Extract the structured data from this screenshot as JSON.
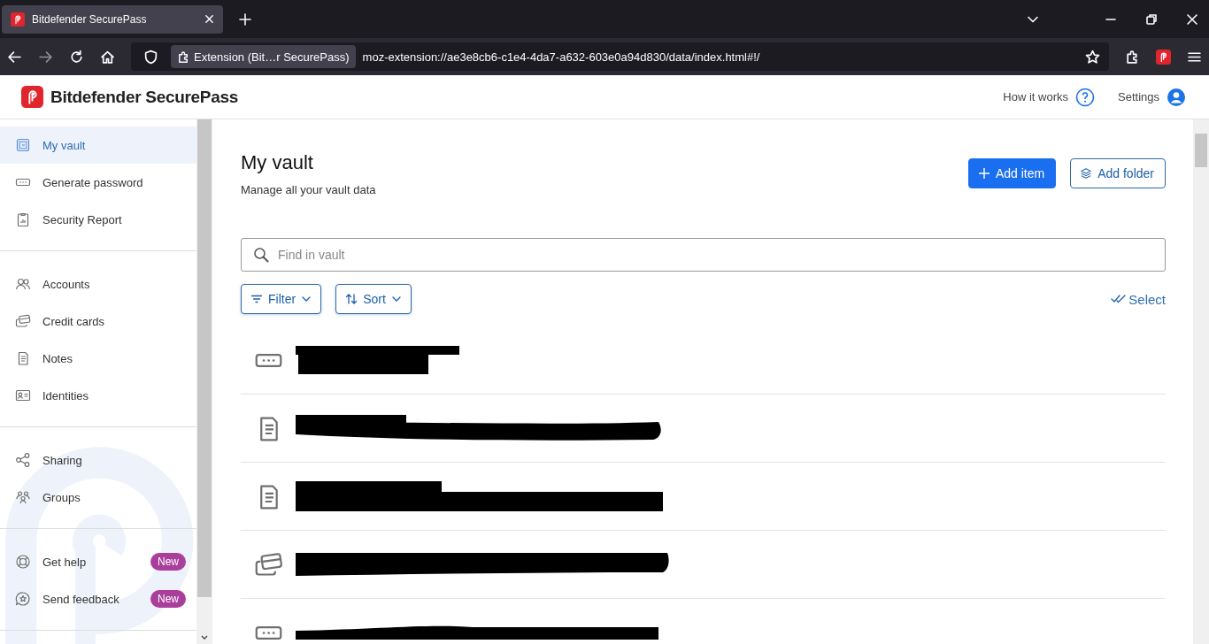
{
  "browser": {
    "tabs": [
      {
        "title": "Bitdefender SecurePass",
        "selected": true
      }
    ],
    "identity": "Extension (Bit…r SecurePass)",
    "url": "moz-extension://ae3e8cb6-c1e4-4da7-a632-603e0a94d830/data/index.html#!/"
  },
  "header": {
    "brand": "Bitdefender",
    "product": "SecurePass",
    "links": [
      {
        "label": "How it works",
        "kind": "help"
      },
      {
        "label": "Settings",
        "kind": "account"
      }
    ]
  },
  "sidebar": {
    "groups": [
      [
        {
          "label": "My vault",
          "kind": "vault",
          "selected": true
        },
        {
          "label": "Generate password",
          "kind": "password",
          "selected": false
        },
        {
          "label": "Security Report",
          "kind": "report",
          "selected": false
        }
      ],
      [
        {
          "label": "Accounts",
          "kind": "people",
          "selected": false
        },
        {
          "label": "Credit cards",
          "kind": "card",
          "selected": false
        },
        {
          "label": "Notes",
          "kind": "note",
          "selected": false
        },
        {
          "label": "Identities",
          "kind": "identity",
          "selected": false
        }
      ],
      [
        {
          "label": "Sharing",
          "kind": "share",
          "selected": false
        },
        {
          "label": "Groups",
          "kind": "group",
          "selected": false
        }
      ],
      [
        {
          "label": "Get help",
          "kind": "help",
          "selected": false,
          "badge": "New"
        },
        {
          "label": "Send feedback",
          "kind": "feedback",
          "selected": false,
          "badge": "New"
        }
      ]
    ]
  },
  "main": {
    "title": "My vault",
    "subtitle": "Manage all your vault data",
    "actions": [
      {
        "label": "Add item",
        "kind": "primary"
      },
      {
        "label": "Add folder",
        "kind": "secondary"
      }
    ],
    "search": {
      "placeholder": "Find in vault"
    },
    "controls": [
      {
        "label": "Filter",
        "kind": "filter"
      },
      {
        "label": "Sort",
        "kind": "sort"
      }
    ],
    "select": "Select",
    "items": [
      {
        "kind": "password"
      },
      {
        "kind": "note"
      },
      {
        "kind": "note"
      },
      {
        "kind": "card"
      },
      {
        "kind": "password"
      }
    ]
  }
}
